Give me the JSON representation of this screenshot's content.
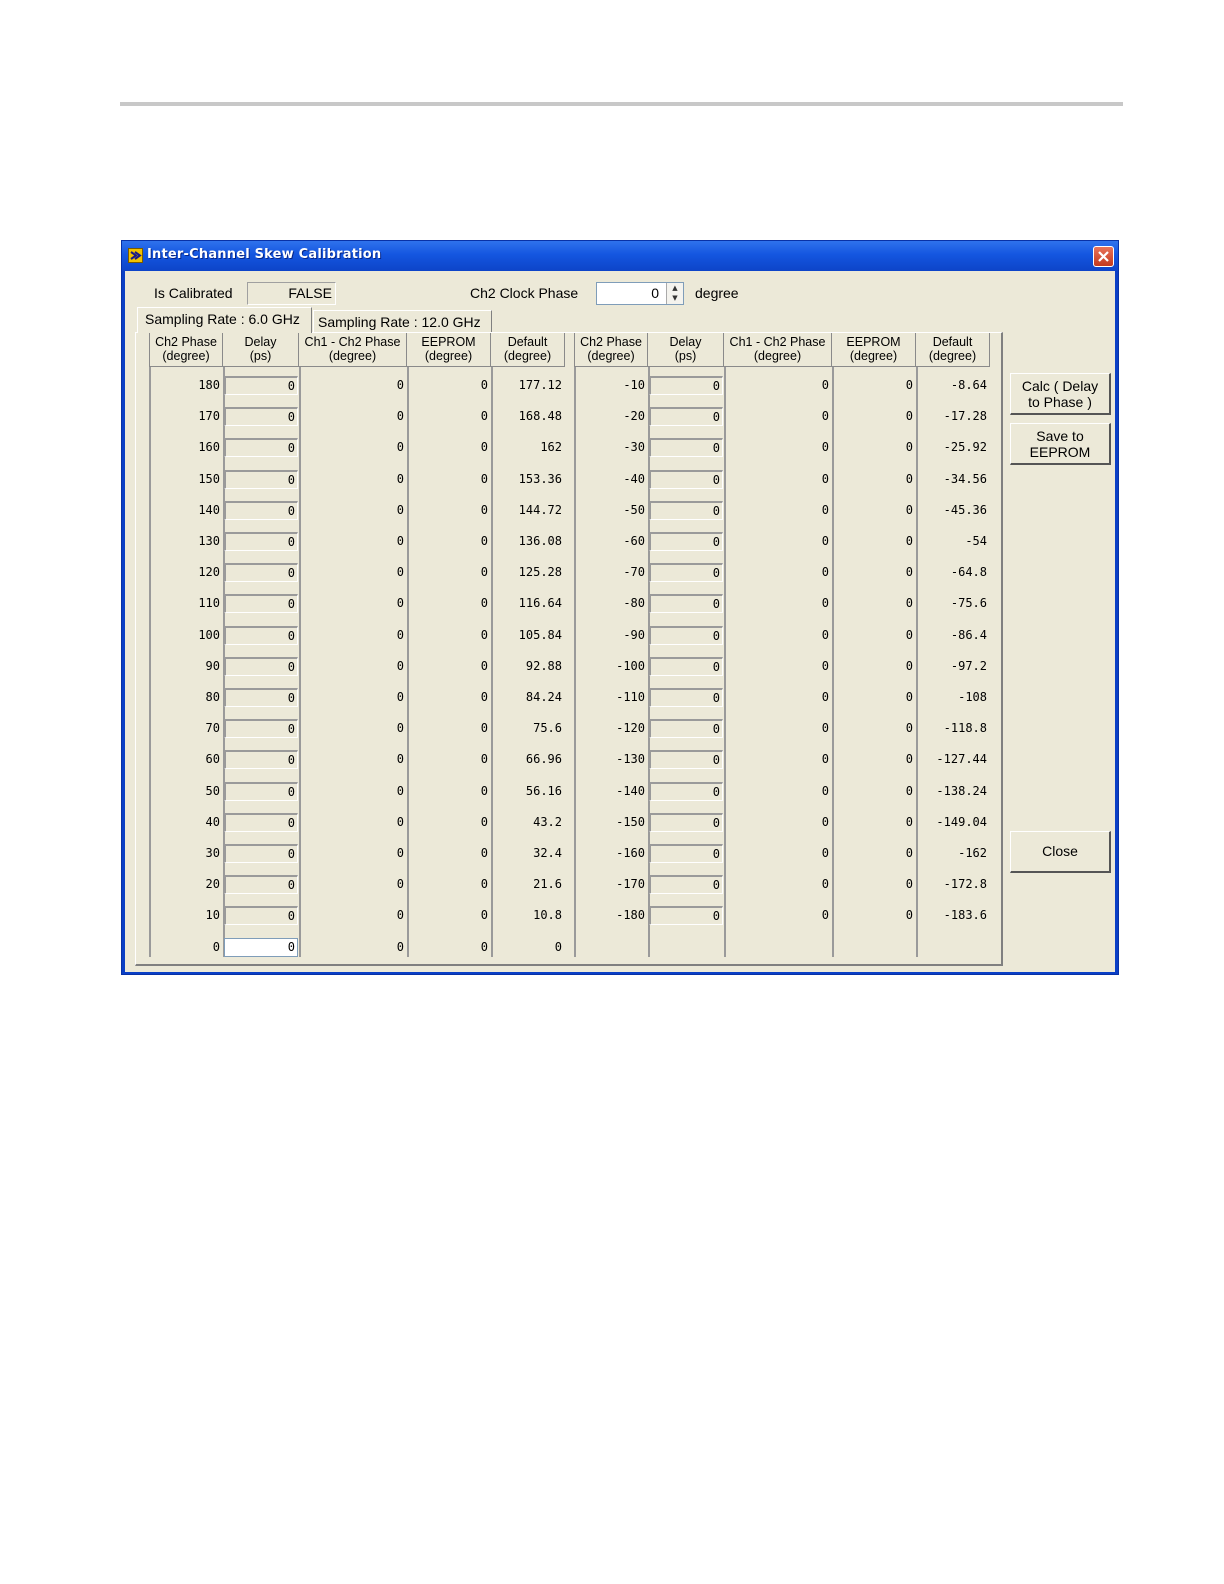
{
  "window": {
    "title": "Inter-Channel Skew Calibration"
  },
  "status": {
    "is_calibrated_label": "Is Calibrated",
    "is_calibrated_value": "FALSE"
  },
  "clock": {
    "label": "Ch2 Clock Phase",
    "value": "0",
    "unit": "degree"
  },
  "tabs": [
    "Sampling Rate : 6.0 GHz",
    "Sampling Rate : 12.0 GHz"
  ],
  "headers": [
    "Ch2 Phase\n(degree)",
    "Delay\n(ps)",
    "Ch1 - Ch2 Phase\n(degree)",
    "EEPROM\n(degree)",
    "Default\n(degree)"
  ],
  "left_rows": [
    [
      "180",
      "0",
      "0",
      "0",
      "177.12"
    ],
    [
      "170",
      "0",
      "0",
      "0",
      "168.48"
    ],
    [
      "160",
      "0",
      "0",
      "0",
      "162"
    ],
    [
      "150",
      "0",
      "0",
      "0",
      "153.36"
    ],
    [
      "140",
      "0",
      "0",
      "0",
      "144.72"
    ],
    [
      "130",
      "0",
      "0",
      "0",
      "136.08"
    ],
    [
      "120",
      "0",
      "0",
      "0",
      "125.28"
    ],
    [
      "110",
      "0",
      "0",
      "0",
      "116.64"
    ],
    [
      "100",
      "0",
      "0",
      "0",
      "105.84"
    ],
    [
      "90",
      "0",
      "0",
      "0",
      "92.88"
    ],
    [
      "80",
      "0",
      "0",
      "0",
      "84.24"
    ],
    [
      "70",
      "0",
      "0",
      "0",
      "75.6"
    ],
    [
      "60",
      "0",
      "0",
      "0",
      "66.96"
    ],
    [
      "50",
      "0",
      "0",
      "0",
      "56.16"
    ],
    [
      "40",
      "0",
      "0",
      "0",
      "43.2"
    ],
    [
      "30",
      "0",
      "0",
      "0",
      "32.4"
    ],
    [
      "20",
      "0",
      "0",
      "0",
      "21.6"
    ],
    [
      "10",
      "0",
      "0",
      "0",
      "10.8"
    ],
    [
      "0",
      "0",
      "0",
      "0",
      "0"
    ]
  ],
  "right_rows": [
    [
      "-10",
      "0",
      "0",
      "0",
      "-8.64"
    ],
    [
      "-20",
      "0",
      "0",
      "0",
      "-17.28"
    ],
    [
      "-30",
      "0",
      "0",
      "0",
      "-25.92"
    ],
    [
      "-40",
      "0",
      "0",
      "0",
      "-34.56"
    ],
    [
      "-50",
      "0",
      "0",
      "0",
      "-45.36"
    ],
    [
      "-60",
      "0",
      "0",
      "0",
      "-54"
    ],
    [
      "-70",
      "0",
      "0",
      "0",
      "-64.8"
    ],
    [
      "-80",
      "0",
      "0",
      "0",
      "-75.6"
    ],
    [
      "-90",
      "0",
      "0",
      "0",
      "-86.4"
    ],
    [
      "-100",
      "0",
      "0",
      "0",
      "-97.2"
    ],
    [
      "-110",
      "0",
      "0",
      "0",
      "-108"
    ],
    [
      "-120",
      "0",
      "0",
      "0",
      "-118.8"
    ],
    [
      "-130",
      "0",
      "0",
      "0",
      "-127.44"
    ],
    [
      "-140",
      "0",
      "0",
      "0",
      "-138.24"
    ],
    [
      "-150",
      "0",
      "0",
      "0",
      "-149.04"
    ],
    [
      "-160",
      "0",
      "0",
      "0",
      "-162"
    ],
    [
      "-170",
      "0",
      "0",
      "0",
      "-172.8"
    ],
    [
      "-180",
      "0",
      "0",
      "0",
      "-183.6"
    ]
  ],
  "buttons": {
    "calc": "Calc ( Delay\nto Phase )",
    "save": "Save to\nEEPROM",
    "close": "Close"
  }
}
